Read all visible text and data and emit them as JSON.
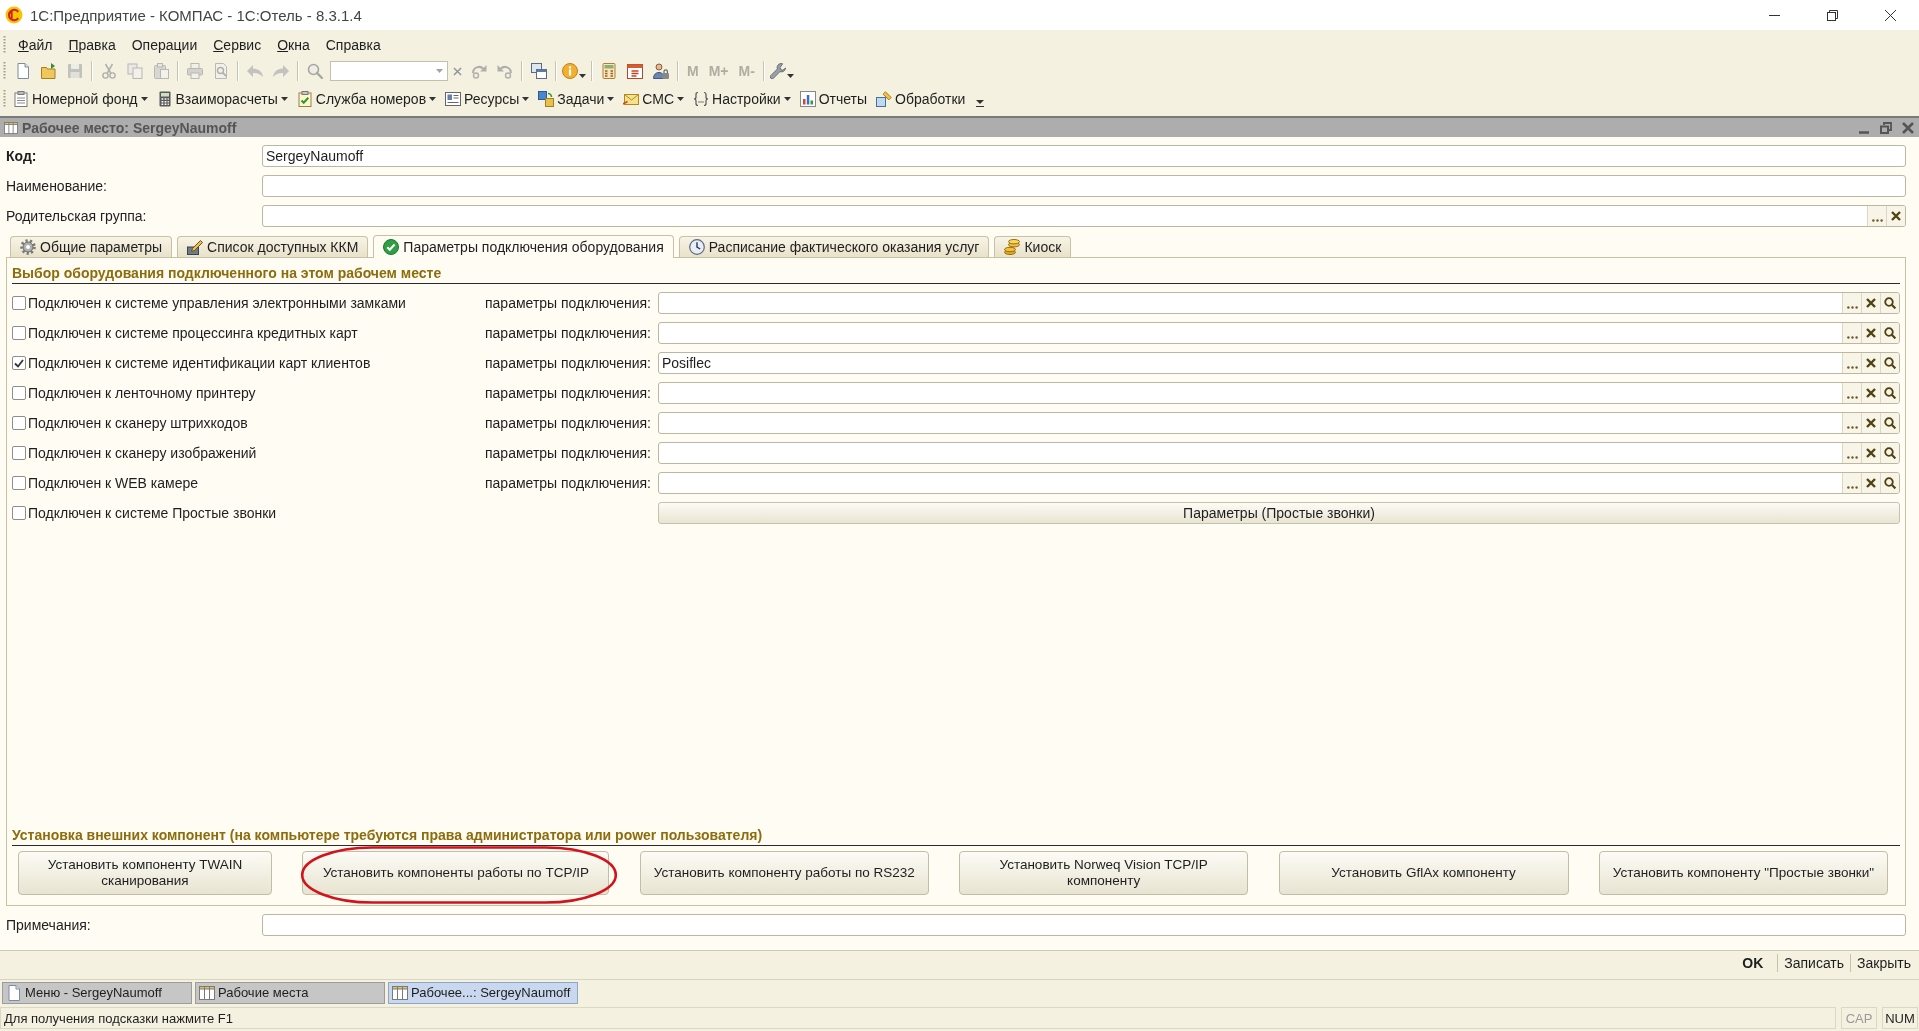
{
  "window": {
    "title": "1С:Предприятие - КОМПАС - 1С:Отель - 8.3.1.4"
  },
  "menu": [
    {
      "label": "Файл",
      "access_key": true
    },
    {
      "label": "Правка",
      "access_key": true
    },
    {
      "label": "Операции",
      "access_key": false
    },
    {
      "label": "Сервис",
      "access_key": true
    },
    {
      "label": "Окна",
      "access_key": true
    },
    {
      "label": "Справка",
      "access_key": false
    }
  ],
  "toolbar": [
    {
      "kind": "button",
      "disabled": false,
      "dropdown": false
    },
    {
      "kind": "button",
      "disabled": false,
      "dropdown": false
    },
    {
      "kind": "button",
      "disabled": true,
      "dropdown": false
    },
    {
      "kind": "separator"
    },
    {
      "kind": "button",
      "disabled": true,
      "dropdown": false
    },
    {
      "kind": "button",
      "disabled": true,
      "dropdown": false
    },
    {
      "kind": "button",
      "disabled": true,
      "dropdown": false
    },
    {
      "kind": "separator"
    },
    {
      "kind": "button",
      "disabled": true,
      "dropdown": false
    },
    {
      "kind": "button",
      "disabled": true,
      "dropdown": false
    },
    {
      "kind": "separator"
    },
    {
      "kind": "button",
      "disabled": true,
      "dropdown": false
    },
    {
      "kind": "button",
      "disabled": true,
      "dropdown": false
    },
    {
      "kind": "separator"
    },
    {
      "kind": "button",
      "disabled": true,
      "dropdown": false
    },
    {
      "kind": "search"
    },
    {
      "kind": "button",
      "disabled": true,
      "dropdown": false
    },
    {
      "kind": "button",
      "disabled": true,
      "dropdown": false
    },
    {
      "kind": "separator"
    },
    {
      "kind": "button",
      "disabled": false,
      "dropdown": false
    },
    {
      "kind": "separator"
    },
    {
      "kind": "button",
      "disabled": false,
      "dropdown": true
    },
    {
      "kind": "separator"
    },
    {
      "kind": "button",
      "disabled": false,
      "dropdown": false
    },
    {
      "kind": "button",
      "disabled": false,
      "dropdown": false
    },
    {
      "kind": "button",
      "disabled": false,
      "dropdown": false
    },
    {
      "kind": "separator"
    },
    {
      "kind": "text",
      "label": "M",
      "disabled": true
    },
    {
      "kind": "text",
      "label": "M+",
      "disabled": true
    },
    {
      "kind": "text",
      "label": "M-",
      "disabled": true
    },
    {
      "kind": "separator"
    },
    {
      "kind": "button",
      "disabled": false,
      "dropdown": true
    }
  ],
  "navigation_bar": [
    {
      "label": "Номерной фонд",
      "dropdown": true
    },
    {
      "label": "Взаиморасчеты",
      "dropdown": true
    },
    {
      "label": "Служба номеров",
      "dropdown": true
    },
    {
      "label": "Ресурсы",
      "dropdown": true
    },
    {
      "label": "Задачи",
      "dropdown": true
    },
    {
      "label": "СМС",
      "dropdown": true
    },
    {
      "label": "Настройки",
      "dropdown": true
    },
    {
      "label": "Отчеты",
      "dropdown": false
    },
    {
      "label": "Обработки",
      "dropdown": false
    }
  ],
  "document_window": {
    "title": "Рабочее место: SergeyNaumoff"
  },
  "fields": [
    {
      "label": "Код:",
      "value": "SergeyNaumoff",
      "kind": "text",
      "emphasized": true
    },
    {
      "label": "Наименование:",
      "kind": "text",
      "emphasized": false
    },
    {
      "label": "Родительская группа:",
      "kind": "choice",
      "emphasized": false
    }
  ],
  "tabs": [
    {
      "label": "Общие параметры",
      "selected": false
    },
    {
      "label": "Список доступных ККМ",
      "selected": false
    },
    {
      "label": "Параметры подключения оборудования",
      "selected": true
    },
    {
      "label": "Расписание фактического оказания услуг",
      "selected": false
    },
    {
      "label": "Киоск",
      "selected": false
    }
  ],
  "equipment": {
    "title": "Выбор оборудования подключенного на этом рабочем месте",
    "rows": [
      {
        "kind": "field",
        "label": "Подключен к системе управления электронными замками",
        "checked": false,
        "params_label": "параметры подключения:"
      },
      {
        "kind": "field",
        "label": "Подключен к системе процессинга кредитных карт",
        "checked": false,
        "params_label": "параметры подключения:"
      },
      {
        "kind": "field",
        "label": "Подключен к системе идентификации карт клиентов",
        "checked": true,
        "params_label": "параметры подключения:",
        "value": "Posiflec"
      },
      {
        "kind": "field",
        "label": "Подключен к ленточному принтеру",
        "checked": false,
        "params_label": "параметры подключения:"
      },
      {
        "kind": "field",
        "label": "Подключен к сканеру штрихкодов",
        "checked": false,
        "params_label": "параметры подключения:"
      },
      {
        "kind": "field",
        "label": "Подключен к сканеру изображений",
        "checked": false,
        "params_label": "параметры подключения:"
      },
      {
        "kind": "field",
        "label": "Подключен к WEB камере",
        "checked": false,
        "params_label": "параметры подключения:"
      },
      {
        "kind": "button",
        "label": "Подключен к системе Простые звонки",
        "checked": false,
        "button": "Параметры (Простые звонки)"
      }
    ]
  },
  "install": {
    "title": "Установка внешних компонент (на компьютере требуются права администратора или power пользователя)",
    "buttons": [
      {
        "label": "Установить компоненту TWAIN сканирования",
        "highlighted": false
      },
      {
        "label": "Установить компоненты работы по TCP/IP",
        "highlighted": true
      },
      {
        "label": "Установить компоненту работы по RS232",
        "highlighted": false
      },
      {
        "label": "Установить Norweq Vision TCP/IP компоненту",
        "highlighted": false
      },
      {
        "label": "Установить GflAx компоненту",
        "highlighted": false
      },
      {
        "label": "Установить компоненту \"Простые звонки\"",
        "highlighted": false
      }
    ]
  },
  "notes": {
    "label": "Примечания:"
  },
  "footer_buttons": [
    {
      "label": "OK",
      "default": true
    },
    {
      "label": "Записать",
      "default": false
    },
    {
      "label": "Закрыть",
      "default": false
    }
  ],
  "taskbar": [
    {
      "label": "Меню - SergeyNaumoff",
      "selected": false
    },
    {
      "label": "Рабочие места",
      "selected": false
    },
    {
      "label": "Рабочее...: SergeyNaumoff",
      "selected": true
    }
  ],
  "status_bar": {
    "hint": "Для получения подсказки нажмите F1",
    "indicators": [
      {
        "label": "CAP",
        "on": false
      },
      {
        "label": "NUM",
        "on": true
      }
    ]
  }
}
